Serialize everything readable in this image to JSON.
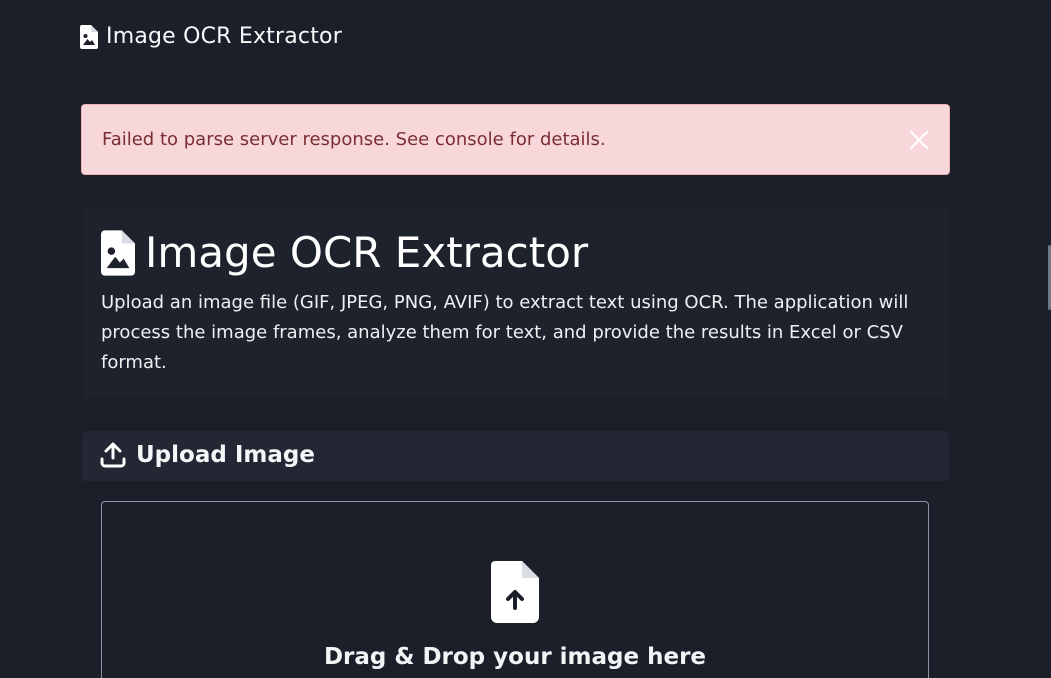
{
  "navbar": {
    "brand": "Image OCR Extractor",
    "brand_icon": "file-image-icon"
  },
  "alert": {
    "message": "Failed to parse server response. See console for details.",
    "close_icon": "close-icon",
    "colors": {
      "background": "#f8d7da",
      "text": "#7a2e33"
    }
  },
  "hero": {
    "title": "Image OCR Extractor",
    "title_icon": "file-image-icon",
    "description": "Upload an image file (GIF, JPEG, PNG, AVIF) to extract text using OCR. The application will process the image frames, analyze them for text, and provide the results in Excel or CSV format."
  },
  "upload_card": {
    "title": "Upload Image",
    "title_icon": "upload-icon",
    "dropzone": {
      "icon": "file-upload-icon",
      "text": "Drag & Drop your image here"
    }
  },
  "theme": {
    "background": "#1b1f2a",
    "card_header": "#222733"
  }
}
